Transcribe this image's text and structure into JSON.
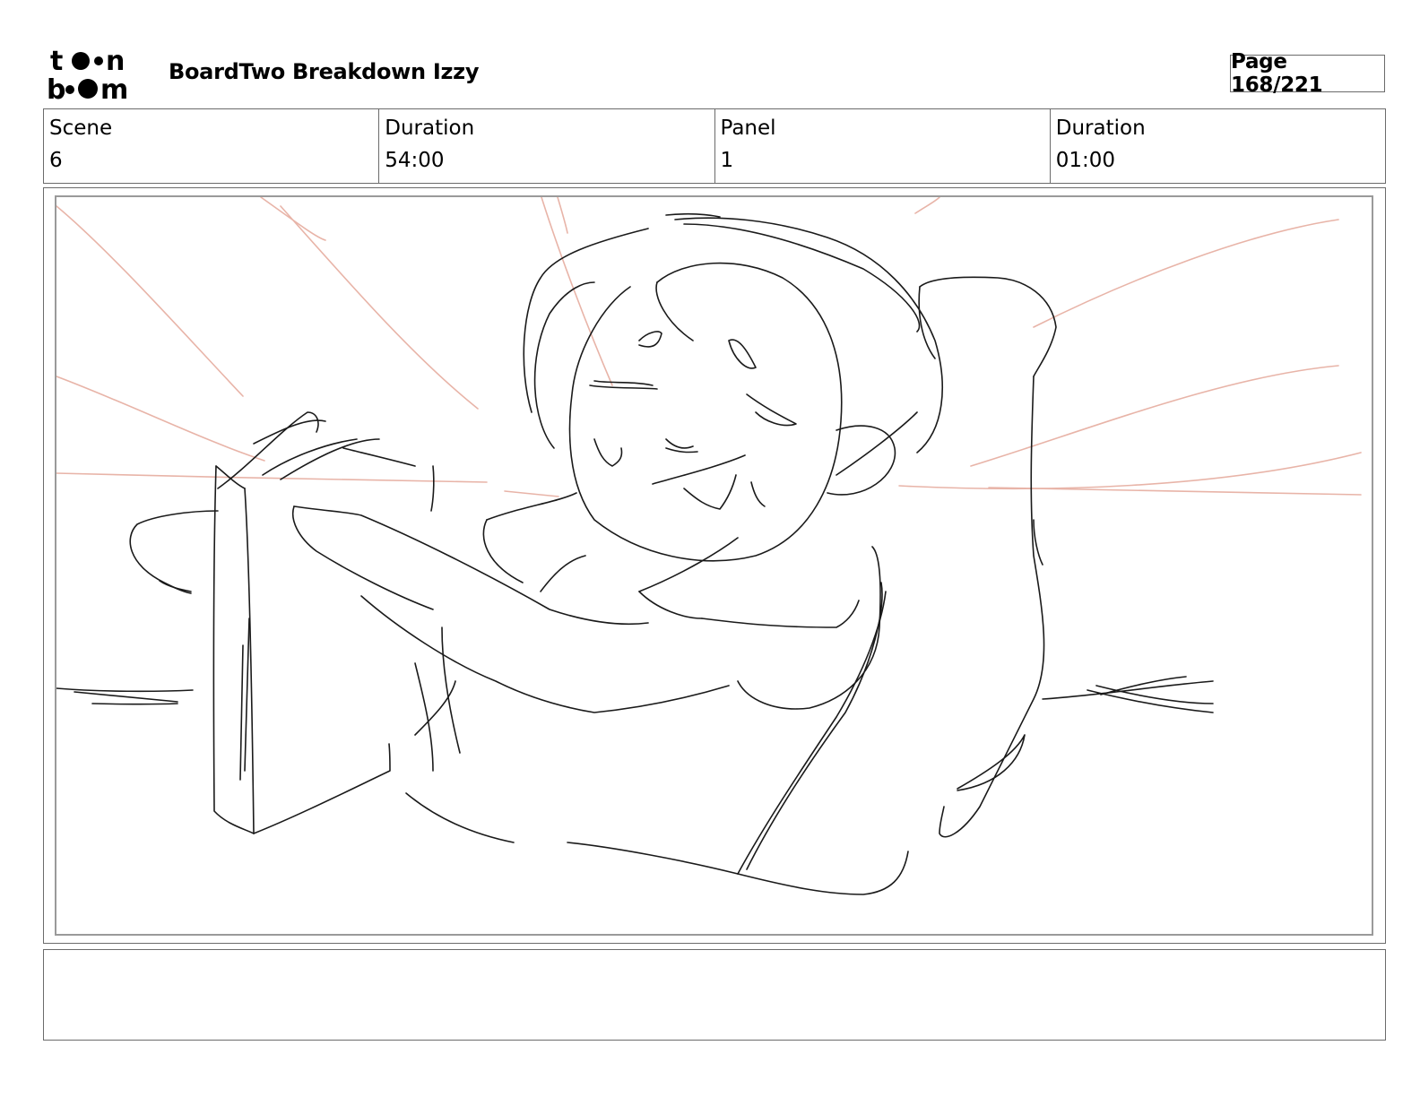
{
  "header": {
    "logo": "toon boom",
    "title": "BoardTwo Breakdown Izzy",
    "page": "Page 168/221"
  },
  "info": [
    {
      "label": "Scene",
      "value": "6"
    },
    {
      "label": "Duration",
      "value": "54:00"
    },
    {
      "label": "Panel",
      "value": "1"
    },
    {
      "label": "Duration",
      "value": "01:00"
    }
  ],
  "panel": {
    "sketch_color": "#1a1a1a",
    "guide_color": "#e8b4a8"
  },
  "notes": {
    "text": ""
  }
}
